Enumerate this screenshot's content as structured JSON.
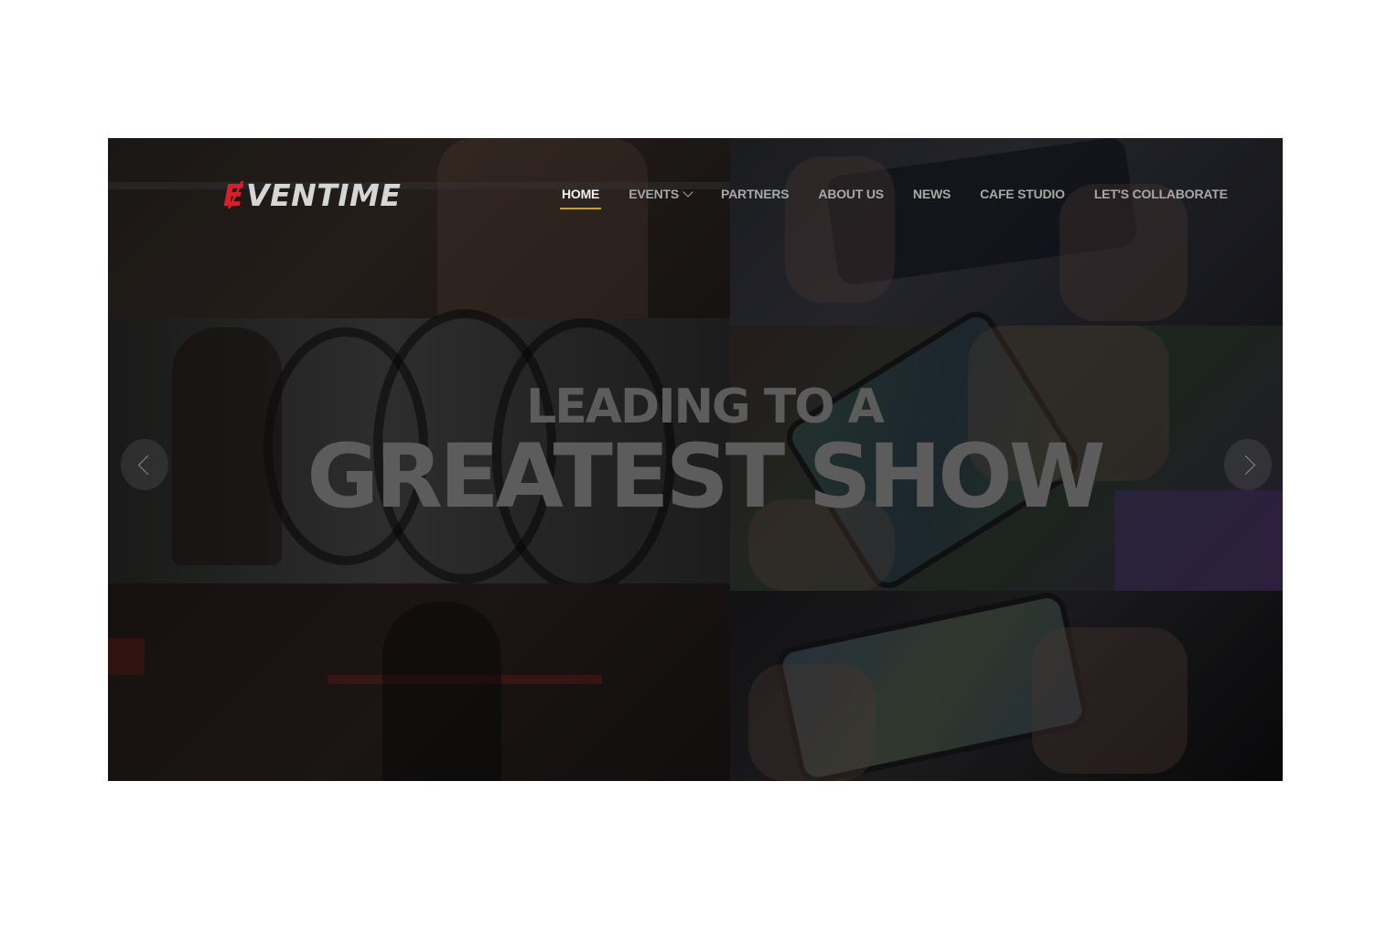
{
  "brand": {
    "logo_mark": "Ɇ",
    "logo_text": "VENTIME",
    "accent_color": "#d6212a",
    "nav_underline_color": "#c9a416"
  },
  "nav": {
    "items": [
      {
        "label": "HOME",
        "active": true
      },
      {
        "label": "EVENTS",
        "has_dropdown": true
      },
      {
        "label": "PARTNERS"
      },
      {
        "label": "ABOUT US"
      },
      {
        "label": "NEWS"
      },
      {
        "label": "CAFE STUDIO"
      },
      {
        "label": "LET'S COLLABORATE"
      }
    ]
  },
  "hero": {
    "headline_small": "LEADING TO A",
    "headline_big": "GREATEST SHOW",
    "prev_icon": "chevron-left-icon",
    "next_icon": "chevron-right-icon"
  }
}
